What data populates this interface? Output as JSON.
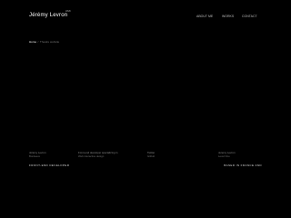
{
  "header": {
    "logo_text": "Jérémy Levron",
    "logo_sup": "WEB",
    "nav": [
      {
        "label": "ABOUT ME"
      },
      {
        "label": "WORKS"
      },
      {
        "label": "CONTACT"
      }
    ]
  },
  "breadcrumb": {
    "home": "Home",
    "separator": "/",
    "current": "Theatre website"
  },
  "footer": {
    "col1": {
      "line1": "Jérémy Levron",
      "line2": "Bordeaux"
    },
    "col2": {
      "line1": "Front-end developer specializing in",
      "line2": "Web interactive design"
    },
    "col3": {
      "line1": "Twitter",
      "line2": "Github"
    },
    "col4": {
      "line1": "Jeremy Levron",
      "line2": "Level One"
    },
    "left_tagline": "FRONT-END DEVELOPER",
    "right_tagline": "BASED IN FRANCE AND"
  }
}
